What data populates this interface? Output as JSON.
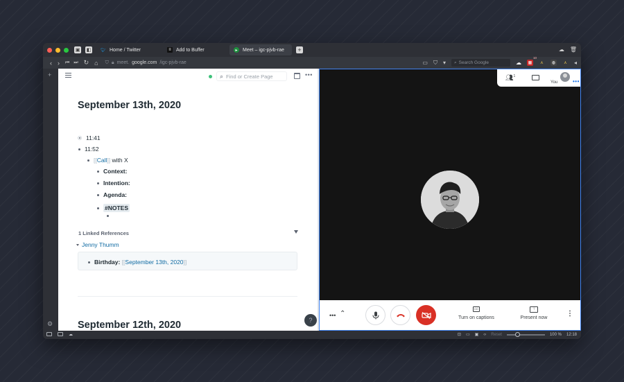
{
  "browser": {
    "tabs": [
      {
        "label": "Home / Twitter",
        "icon": "twitter-icon"
      },
      {
        "label": "Add to Buffer",
        "icon": "buffer-icon"
      },
      {
        "label": "Meet – igc-pjvb-rae",
        "icon": "meet-icon"
      }
    ],
    "url": {
      "prefix": "meet.",
      "host": "google.com",
      "path": "/igc-pjvb-rae"
    },
    "search_placeholder": "Search Google",
    "ext_badge": "10"
  },
  "roam": {
    "search_placeholder": "Find or Create Page",
    "page1_title": "September 13th, 2020",
    "blocks": {
      "b1": "11:41",
      "b2": "11:52",
      "call_ref": "Call",
      "call_suffix": "with X",
      "context": "Context:",
      "intention": "Intention:",
      "agenda": "Agenda:",
      "notes": "#NOTES"
    },
    "linked_refs": {
      "header": "1 Linked References",
      "source_page": "Jenny Thumm",
      "block_label": "Birthday:",
      "block_ref": "September 13th, 2020"
    },
    "page2_title": "September 12th, 2020"
  },
  "meet": {
    "participants_count": "1",
    "you_label": "You",
    "captions_label": "Turn on captions",
    "present_label": "Present now"
  },
  "status": {
    "reset_label": "Reset",
    "zoom": "100 %",
    "time": "12:18"
  },
  "colors": {
    "link": "#106ba3",
    "hangup_red": "#d93025",
    "meet_border": "#4285f4"
  }
}
